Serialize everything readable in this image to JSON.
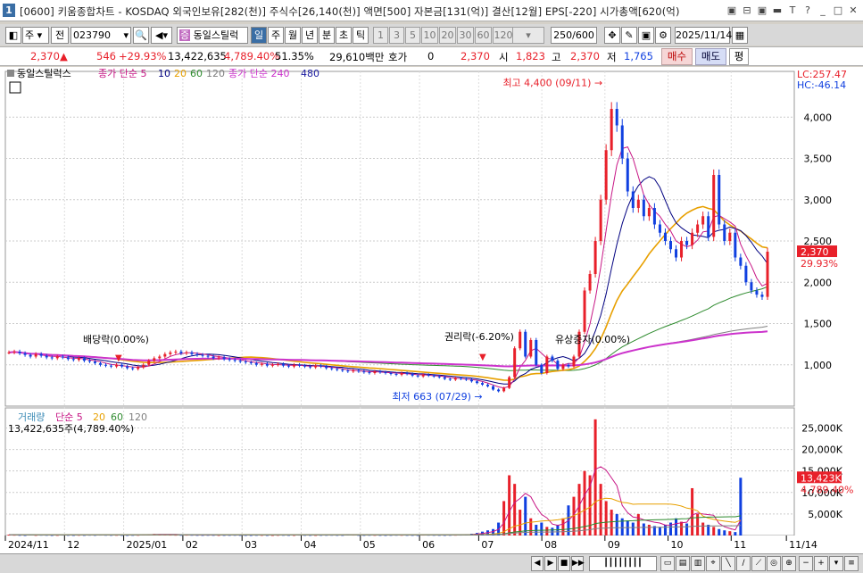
{
  "window": {
    "number": "1",
    "title": "[0600] 키움종합차트 - KOSDAQ 외국인보유[282(천)] 주식수[26,140(천)] 액면[500] 자본금[131(억)] 결산[12월] EPS[-220] 시가총액[620(억)",
    "controls": [
      "▣",
      "⊟",
      "▣",
      "▬",
      "T",
      "?",
      "_",
      "□",
      "✕"
    ]
  },
  "toolbar": {
    "period_kind": "주",
    "prev_label": "전",
    "code": "023790",
    "stock_name": "동일스틸럭",
    "tabs": [
      "일",
      "주",
      "월",
      "년",
      "분",
      "초",
      "틱"
    ],
    "active_tab": "일",
    "minute_options": [
      "1",
      "3",
      "5",
      "10",
      "20",
      "30",
      "60",
      "120"
    ],
    "count": "250/600",
    "date": "2025/11/14"
  },
  "quote": {
    "price": "2,370",
    "change": "546",
    "change_pct": "+29.93%",
    "volume": "13,422,635",
    "volume_pct": "4,789.40%",
    "turnover_pct": "51.35%",
    "amount": "29,610백만",
    "hoga_label": "호가",
    "hoga_value": "0",
    "hoga_price": "2,370",
    "open_label": "시",
    "open": "1,823",
    "high_label": "고",
    "high": "2,370",
    "low_label": "저",
    "low": "1,765",
    "buy_label": "매수",
    "sell_label": "매도",
    "flat_label": "평"
  },
  "colors": {
    "up": "#e8202a",
    "down": "#1040e0",
    "ma5": "#c71585",
    "ma10": "#000080",
    "ma20": "#e8a000",
    "ma60": "#2e8b2e",
    "ma120": "#808080",
    "ma240": "#cc33cc",
    "ma480": "#1a1aa0"
  },
  "chart_data": [
    {
      "type": "candlestick",
      "title": "동일스틸럭스",
      "legend": [
        "종가 단순 5",
        "10",
        "20",
        "60",
        "120",
        "종가 단순 240",
        "480"
      ],
      "price_axis": {
        "ticks": [
          "4,000",
          "3,500",
          "3,000",
          "2,500",
          "2,000",
          "1,500",
          "1,000"
        ],
        "ylim": [
          500,
          4500
        ]
      },
      "x_labels": [
        "2024/11",
        "12",
        "2025/01",
        "02",
        "03",
        "04",
        "05",
        "06",
        "07",
        "08",
        "09",
        "10",
        "11",
        "11/14"
      ],
      "lc_label": "LC:257.47",
      "hc_label": "HC:-46.14",
      "last_price_label": "2,370",
      "last_pct_label": "29.93%",
      "annotations": [
        {
          "text": "최고 4,400 (09/11)",
          "value": 4400
        },
        {
          "text": "최저 663 (07/29)",
          "value": 663
        },
        {
          "text": "배당락(0.00%)"
        },
        {
          "text": "권리락(-6.20%)"
        },
        {
          "text": "유상증자(0.00%)"
        }
      ],
      "closes": [
        1150,
        1160,
        1140,
        1120,
        1100,
        1130,
        1110,
        1090,
        1080,
        1100,
        1090,
        1070,
        1060,
        1080,
        1050,
        1040,
        1020,
        1000,
        990,
        980,
        1000,
        980,
        960,
        950,
        970,
        1000,
        1050,
        1080,
        1100,
        1130,
        1150,
        1160,
        1140,
        1150,
        1130,
        1120,
        1110,
        1100,
        1080,
        1090,
        1070,
        1060,
        1050,
        1040,
        1030,
        1020,
        1000,
        1010,
        990,
        1000,
        1010,
        990,
        980,
        1000,
        990,
        980,
        970,
        990,
        980,
        960,
        950,
        940,
        930,
        920,
        930,
        920,
        910,
        900,
        920,
        910,
        900,
        890,
        880,
        900,
        890,
        870,
        860,
        880,
        870,
        860,
        850,
        830,
        820,
        840,
        830,
        820,
        800,
        780,
        760,
        740,
        700,
        680,
        720,
        850,
        1200,
        1400,
        1100,
        1300,
        1000,
        900,
        1100,
        1050,
        950,
        1000,
        980,
        1100,
        1400,
        1900,
        2100,
        2500,
        3000,
        3600,
        4100,
        3900,
        3500,
        3100,
        2900,
        3000,
        2800,
        2900,
        2700,
        2600,
        2500,
        2400,
        2300,
        2500,
        2450,
        2600,
        2700,
        2800,
        2550,
        3300,
        2700,
        2500,
        2600,
        2300,
        2200,
        2000,
        1900,
        1850,
        1823,
        2370
      ],
      "volume": {
        "label": "거래량",
        "legend": [
          "단순 5",
          "20",
          "60",
          "120"
        ],
        "summary": "13,422,635주(4,789.40%)",
        "ticks": [
          "25,000K",
          "20,000K",
          "15,000K",
          "10,000K",
          "5,000K"
        ],
        "ylim": [
          0,
          28000
        ],
        "last_label": "13,423K",
        "last_pct_label": "4,789.40%",
        "values": [
          200,
          180,
          150,
          120,
          260,
          140,
          180,
          160,
          120,
          140,
          200,
          150,
          130,
          160,
          140,
          180,
          150,
          200,
          170,
          150,
          160,
          140,
          130,
          150,
          160,
          220,
          300,
          350,
          260,
          240,
          200,
          180,
          160,
          190,
          170,
          150,
          140,
          160,
          150,
          130,
          140,
          150,
          160,
          140,
          130,
          120,
          150,
          140,
          130,
          120,
          150,
          160,
          140,
          130,
          200,
          150,
          140,
          130,
          150,
          160,
          170,
          150,
          140,
          300,
          200,
          150,
          140,
          160,
          150,
          140,
          130,
          150,
          170,
          160,
          150,
          140,
          130,
          200,
          180,
          160,
          150,
          140,
          160,
          180,
          200,
          240,
          400,
          600,
          900,
          1200,
          1500,
          3000,
          8000,
          14000,
          12000,
          6000,
          9000,
          4000,
          2500,
          3000,
          2000,
          1800,
          2500,
          4000,
          7000,
          9000,
          12000,
          15000,
          14000,
          27000,
          12000,
          8000,
          6000,
          5000,
          4000,
          3500,
          3000,
          5000,
          2800,
          2500,
          2200,
          2000,
          2500,
          3000,
          4000,
          3200,
          2800,
          11000,
          5000,
          3000,
          2500,
          2000,
          1500,
          1200,
          1000,
          800,
          13423
        ]
      }
    }
  ]
}
